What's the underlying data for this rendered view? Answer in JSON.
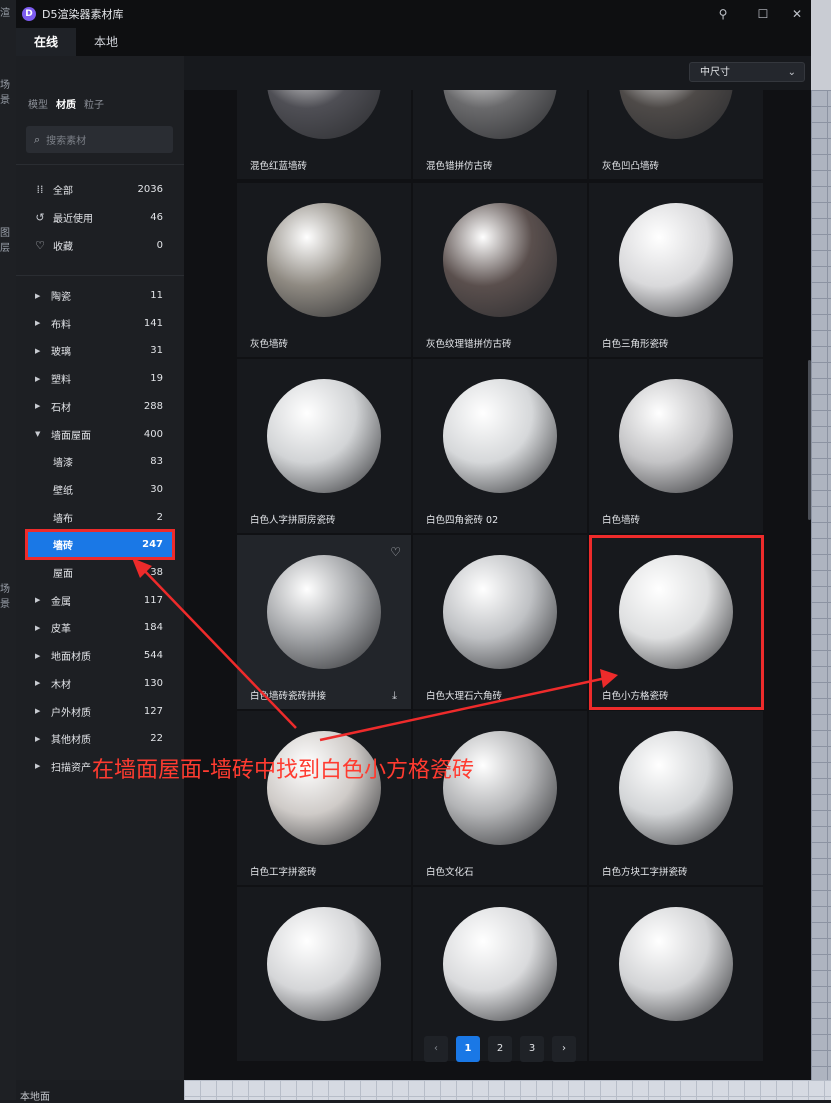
{
  "window": {
    "title": "D5渲染器素材库",
    "logo_letter": "D",
    "tabs": [
      "在线",
      "本地"
    ],
    "active_tab": "在线"
  },
  "background": {
    "left_fragments": [
      "渲",
      "场景",
      "图层",
      "场景"
    ],
    "bottom_fragment": "本地面"
  },
  "toolbar": {
    "size_select": "中尺寸"
  },
  "sidebar": {
    "category_tabs": [
      "模型",
      "材质",
      "粒子"
    ],
    "active_category": "材质",
    "search_placeholder": "搜索素材",
    "top_items": [
      {
        "label": "全部",
        "count": "2036",
        "icon": "grid-icon"
      },
      {
        "label": "最近使用",
        "count": "46",
        "icon": "history-icon"
      },
      {
        "label": "收藏",
        "count": "0",
        "icon": "heart-icon"
      }
    ],
    "categories": [
      {
        "label": "陶瓷",
        "count": "11"
      },
      {
        "label": "布料",
        "count": "141"
      },
      {
        "label": "玻璃",
        "count": "31"
      },
      {
        "label": "塑料",
        "count": "19"
      },
      {
        "label": "石材",
        "count": "288"
      },
      {
        "label": "墙面屋面",
        "count": "400",
        "expanded": true
      },
      {
        "label": "墙漆",
        "count": "83",
        "sub": true
      },
      {
        "label": "壁纸",
        "count": "30",
        "sub": true
      },
      {
        "label": "墙布",
        "count": "2",
        "sub": true
      },
      {
        "label": "墙砖",
        "count": "247",
        "sub": true,
        "selected": true
      },
      {
        "label": "屋面",
        "count": "38",
        "sub": true
      },
      {
        "label": "金属",
        "count": "117"
      },
      {
        "label": "皮革",
        "count": "184"
      },
      {
        "label": "地面材质",
        "count": "544"
      },
      {
        "label": "木材",
        "count": "130"
      },
      {
        "label": "户外材质",
        "count": "127"
      },
      {
        "label": "其他材质",
        "count": "22"
      },
      {
        "label": "扫描资产",
        "count": ""
      }
    ]
  },
  "materials": [
    {
      "label": "混色红蓝墙砖",
      "color": "#4f4f55"
    },
    {
      "label": "混色错拼仿古砖",
      "color": "#6a6a6c"
    },
    {
      "label": "灰色凹凸墙砖",
      "color": "#4e4a48"
    },
    {
      "label": "灰色墙砖",
      "color": "#8f8a82"
    },
    {
      "label": "灰色纹理错拼仿古砖",
      "color": "#5a4f4d"
    },
    {
      "label": "白色三角形瓷砖",
      "color": "#d9d9db"
    },
    {
      "label": "白色人字拼厨房瓷砖",
      "color": "#d2d4d6"
    },
    {
      "label": "白色四角瓷砖 02",
      "color": "#d6d8da"
    },
    {
      "label": "白色墙砖",
      "color": "#c4c4c6"
    },
    {
      "label": "白色墙砖瓷砖拼接",
      "color": "#a3a5a8"
    },
    {
      "label": "白色大理石六角砖",
      "color": "#bfc1c4"
    },
    {
      "label": "白色小方格瓷砖",
      "color": "#dedfe0"
    },
    {
      "label": "白色工字拼瓷砖",
      "color": "#cfcbc8"
    },
    {
      "label": "白色文化石",
      "color": "#b3b4b6"
    },
    {
      "label": "白色方块工字拼瓷砖",
      "color": "#d3d5d7"
    },
    {
      "label": "",
      "color": "#d5d6d8"
    },
    {
      "label": "",
      "color": "#d9dadc"
    },
    {
      "label": "",
      "color": "#d3d4d6"
    }
  ],
  "pagination": {
    "prev": "‹",
    "pages": [
      "1",
      "2",
      "3"
    ],
    "active_page": "1",
    "next": "›"
  },
  "annotation": {
    "text": "在墙面屋面-墙砖中找到白色小方格瓷砖",
    "color": "#ff3b30"
  }
}
